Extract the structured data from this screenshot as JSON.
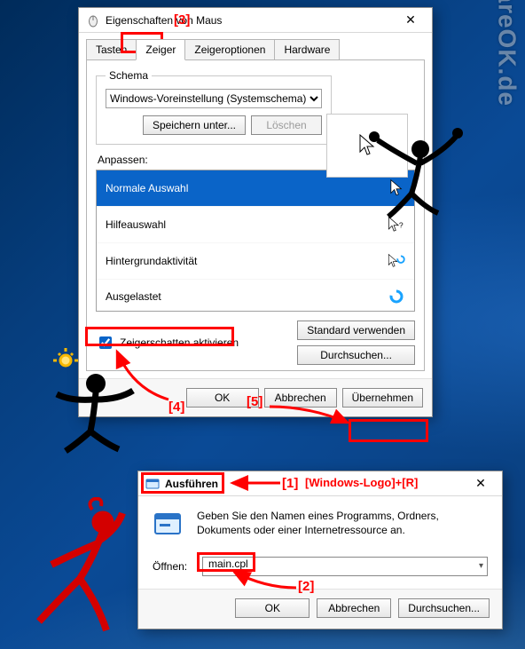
{
  "watermark": "SoftwareOK.de",
  "annotations": {
    "n1": "[1]",
    "n1_hint": "[Windows-Logo]+[R]",
    "n2": "[2]",
    "n3": "[3]",
    "n4": "[4]",
    "n5": "[5]"
  },
  "mouse_dialog": {
    "title": "Eigenschaften von Maus",
    "tabs": [
      "Tasten",
      "Zeiger",
      "Zeigeroptionen",
      "Hardware"
    ],
    "active_tab_index": 1,
    "schema": {
      "legend": "Schema",
      "selected": "Windows-Voreinstellung (Systemschema)",
      "save_as": "Speichern unter...",
      "delete": "Löschen"
    },
    "customize_label": "Anpassen:",
    "items": [
      {
        "label": "Normale Auswahl",
        "icon": "cursor",
        "selected": true
      },
      {
        "label": "Hilfeauswahl",
        "icon": "help-cursor"
      },
      {
        "label": "Hintergrundaktivität",
        "icon": "cursor-spinner"
      },
      {
        "label": "Ausgelastet",
        "icon": "spinner"
      }
    ],
    "shadow_checkbox": "Zeigerschatten aktivieren",
    "shadow_checked": true,
    "use_default": "Standard verwenden",
    "browse": "Durchsuchen...",
    "ok": "OK",
    "cancel": "Abbrechen",
    "apply": "Übernehmen"
  },
  "run_dialog": {
    "title": "Ausführen",
    "description": "Geben Sie den Namen eines Programms, Ordners, Dokuments oder einer Internetressource an.",
    "open_label": "Öffnen:",
    "value": "main.cpl",
    "ok": "OK",
    "cancel": "Abbrechen",
    "browse": "Durchsuchen..."
  }
}
